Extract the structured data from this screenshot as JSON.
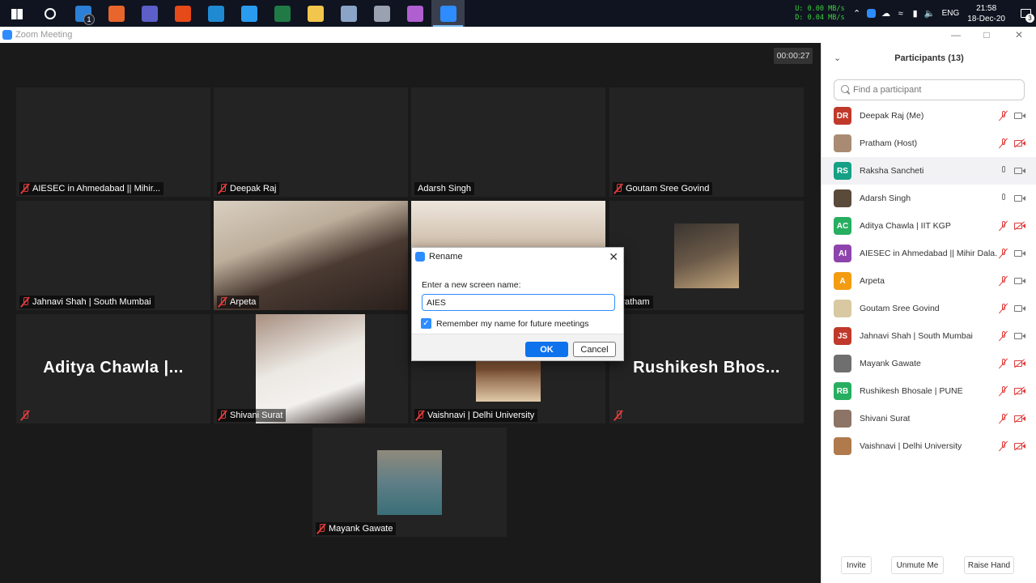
{
  "taskbar": {
    "apps": [
      {
        "icon": "windows-start-icon",
        "color": "#ffffff"
      },
      {
        "icon": "cortana-circle-icon",
        "color": "#ffffff"
      },
      {
        "icon": "mail-icon",
        "color": "#2b7fd6",
        "badge": "1"
      },
      {
        "icon": "firefox-icon",
        "color": "#e8662b"
      },
      {
        "icon": "teams-icon",
        "color": "#5b5fc7"
      },
      {
        "icon": "office-tiles-icon",
        "color": "#e64a19"
      },
      {
        "icon": "vscode-icon",
        "color": "#1f8ad2"
      },
      {
        "icon": "phone-app-icon",
        "color": "#2a9cf0"
      },
      {
        "icon": "excel-icon",
        "color": "#1f7a45"
      },
      {
        "icon": "file-explorer-icon",
        "color": "#f2c64c"
      },
      {
        "icon": "calculator-icon",
        "color": "#8aa4c8"
      },
      {
        "icon": "camera-icon",
        "color": "#9aa2b1"
      },
      {
        "icon": "snip-sketch-icon",
        "color": "#b05fd0"
      },
      {
        "icon": "zoom-icon",
        "color": "#2d8cff"
      }
    ],
    "net_up_label": "U:",
    "net_up_value": "0.00 MB/s",
    "net_down_label": "D:",
    "net_down_value": "0.04 MB/s",
    "language": "ENG",
    "time": "21:58",
    "date": "18-Dec-20",
    "notifications": "3"
  },
  "window": {
    "title": "Zoom Meeting",
    "timer": "00:00:27"
  },
  "tiles": [
    {
      "name": "AIESEC in Ahmedabad || Mihir...",
      "muted": true
    },
    {
      "name": "Deepak Raj",
      "muted": true
    },
    {
      "name": "Adarsh Singh",
      "muted": false
    },
    {
      "name": "Goutam Sree Govind",
      "muted": true
    },
    {
      "name": "Jahnavi Shah | South Mumbai",
      "muted": true
    },
    {
      "name": "Arpeta",
      "muted": true
    },
    {
      "name": "",
      "muted": false
    },
    {
      "name": "Pratham",
      "muted": false
    },
    {
      "name": "",
      "muted": true,
      "big_name": "Aditya Chawla |..."
    },
    {
      "name": "Shivani Surat",
      "muted": true
    },
    {
      "name": "Vaishnavi | Delhi University",
      "muted": true
    },
    {
      "name": "",
      "muted": true,
      "big_name": "Rushikesh Bhos..."
    },
    {
      "name": "Mayank Gawate",
      "muted": true
    }
  ],
  "rename_dialog": {
    "title": "Rename",
    "prompt": "Enter a new screen name:",
    "input_value": "AIES",
    "remember_label": "Remember my name for future meetings",
    "remember_checked": true,
    "ok_label": "OK",
    "cancel_label": "Cancel"
  },
  "participants": {
    "title": "Participants (13)",
    "search_placeholder": "Find a participant",
    "list": [
      {
        "initials": "DR",
        "avatar_color": "#c0392b",
        "name": "Deepak Raj (Me)",
        "mic_on": false,
        "video_on": true
      },
      {
        "initials": "",
        "avatar_color": "#a98b74",
        "name": "Pratham (Host)",
        "mic_on": false,
        "video_on": false
      },
      {
        "initials": "RS",
        "avatar_color": "#16a085",
        "name": "Raksha Sancheti",
        "mic_on": true,
        "video_on": true
      },
      {
        "initials": "",
        "avatar_color": "#5a4a3a",
        "name": "Adarsh Singh",
        "mic_on": true,
        "video_on": true
      },
      {
        "initials": "AC",
        "avatar_color": "#27ae60",
        "name": "Aditya Chawla | IIT KGP",
        "mic_on": false,
        "video_on": false
      },
      {
        "initials": "AI",
        "avatar_color": "#8e44ad",
        "name": "AIESEC in Ahmedabad || Mihir Dala...",
        "mic_on": false,
        "video_on": true
      },
      {
        "initials": "A",
        "avatar_color": "#f39c12",
        "name": "Arpeta",
        "mic_on": false,
        "video_on": true
      },
      {
        "initials": "",
        "avatar_color": "#d8c9a3",
        "name": "Goutam Sree Govind",
        "mic_on": false,
        "video_on": true
      },
      {
        "initials": "JS",
        "avatar_color": "#c0392b",
        "name": "Jahnavi Shah | South Mumbai",
        "mic_on": false,
        "video_on": true
      },
      {
        "initials": "",
        "avatar_color": "#6f6f6f",
        "name": "Mayank Gawate",
        "mic_on": false,
        "video_on": false
      },
      {
        "initials": "RB",
        "avatar_color": "#27ae60",
        "name": "Rushikesh Bhosale | PUNE",
        "mic_on": false,
        "video_on": false
      },
      {
        "initials": "",
        "avatar_color": "#8c7466",
        "name": "Shivani Surat",
        "mic_on": false,
        "video_on": false
      },
      {
        "initials": "",
        "avatar_color": "#b07a4c",
        "name": "Vaishnavi | Delhi University",
        "mic_on": false,
        "video_on": false
      }
    ],
    "invite_label": "Invite",
    "unmute_label": "Unmute Me",
    "raise_hand_label": "Raise Hand"
  }
}
